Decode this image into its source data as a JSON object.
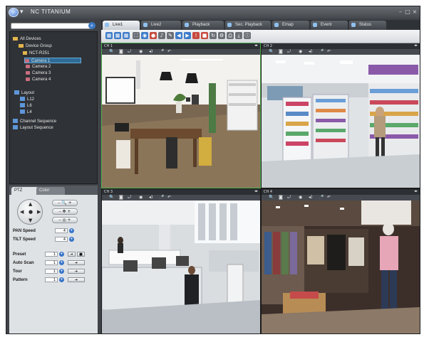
{
  "app": {
    "title": "NC TITANIUM"
  },
  "search": {
    "placeholder": ""
  },
  "tree": {
    "items": [
      {
        "label": "All Devices",
        "icon": "folder-icon"
      },
      {
        "label": "Device Group",
        "icon": "folder-icon"
      },
      {
        "label": "NCT-R251",
        "icon": "device-icon"
      },
      {
        "label": "Camera 1",
        "icon": "camera-icon"
      },
      {
        "label": "Camera 2",
        "icon": "camera-icon"
      },
      {
        "label": "Camera 3",
        "icon": "camera-icon"
      },
      {
        "label": "Camera 4",
        "icon": "camera-icon"
      },
      {
        "label": "Layout",
        "icon": "layout-icon"
      },
      {
        "label": "L12",
        "icon": "layout-icon"
      },
      {
        "label": "L6",
        "icon": "layout-icon"
      },
      {
        "label": "L4",
        "icon": "layout-icon"
      },
      {
        "label": "Channel Sequence",
        "icon": "sequence-icon"
      },
      {
        "label": "Layout Sequence",
        "icon": "sequence-icon"
      }
    ]
  },
  "ptz": {
    "tabs": [
      "PTZ",
      "Color"
    ],
    "pan_label": "PAN Speed",
    "pan_value": "4",
    "tilt_label": "TILT Speed",
    "tilt_value": "4",
    "preset_label": "Preset",
    "preset_value": "1",
    "auto_scan_label": "Auto Scan",
    "auto_scan_value": "1",
    "tour_label": "Tour",
    "tour_value": "1",
    "pattern_label": "Pattern",
    "pattern_value": "1"
  },
  "tabs": [
    {
      "label": "Live1",
      "active": true
    },
    {
      "label": "Live2",
      "active": false
    },
    {
      "label": "Playback",
      "active": false
    },
    {
      "label": "Sec. Playback",
      "active": false
    },
    {
      "label": "Emap",
      "active": false
    },
    {
      "label": "Event",
      "active": false
    },
    {
      "label": "Status",
      "active": false
    }
  ],
  "channels": [
    {
      "label": "CH 1",
      "selected": true
    },
    {
      "label": "CH 2",
      "selected": false
    },
    {
      "label": "CH 3",
      "selected": false
    },
    {
      "label": "CH 4",
      "selected": false
    }
  ],
  "colors": {
    "accent": "#2e6b97",
    "selected_pane": "#4caf50",
    "window_bg": "#3f4247"
  }
}
